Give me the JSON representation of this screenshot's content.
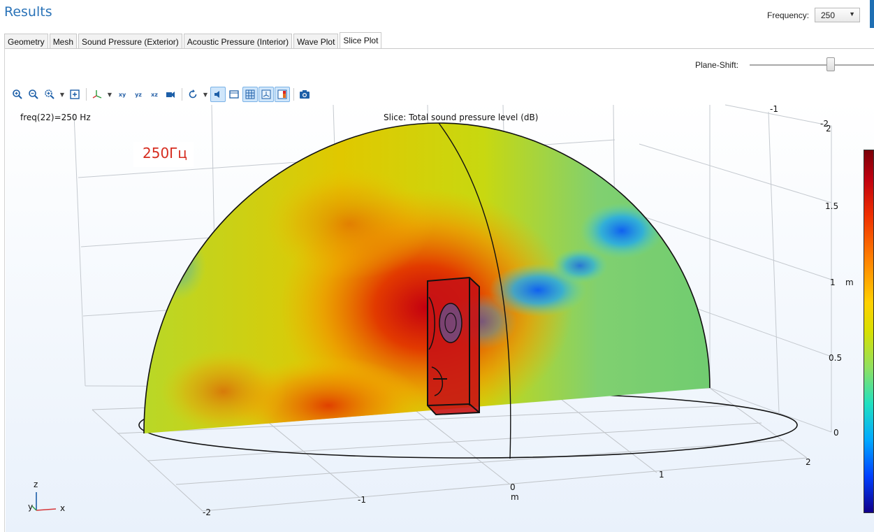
{
  "header": {
    "title": "Results",
    "frequency_label": "Frequency:",
    "frequency_value": "250"
  },
  "tabs": [
    {
      "label": "Geometry"
    },
    {
      "label": "Mesh"
    },
    {
      "label": "Sound Pressure (Exterior)"
    },
    {
      "label": "Acoustic Pressure (Interior)"
    },
    {
      "label": "Wave Plot"
    },
    {
      "label": "Slice Plot"
    }
  ],
  "active_tab": "Slice Plot",
  "controls": {
    "plane_shift_label": "Plane-Shift:",
    "plane_shift_position": 0.65
  },
  "toolbar": {
    "icons": [
      "zoom-in-icon",
      "zoom-out-icon",
      "zoom-box-icon",
      "zoom-extents-icon",
      "axis-orientation-icon",
      "xy-view-icon",
      "yz-view-icon",
      "xz-view-icon",
      "go-to-view-icon",
      "rotate-icon",
      "headlight-icon",
      "scene-light-icon",
      "grid-icon",
      "axis-icon",
      "color-legend-icon",
      "snapshot-icon"
    ],
    "xy_label": "xy",
    "yz_label": "yz",
    "xz_label": "xz"
  },
  "plot": {
    "freq_text": "freq(22)=250 Hz",
    "slice_title": "Slice: Total sound pressure level (dB)",
    "badge": "250Гц",
    "z_axis_ticks": [
      "2",
      "1.5",
      "1",
      "0.5",
      "0"
    ],
    "z_axis_unit": "m",
    "x_axis_ticks": [
      "-2",
      "-1",
      "0",
      "1",
      "2"
    ],
    "x_axis_unit": "m",
    "back_axis_ticks": [
      "-1",
      "-2"
    ],
    "triad_labels": {
      "z": "z",
      "y": "y",
      "x": "x"
    }
  },
  "colors": {
    "title": "#2a73b8",
    "badge": "#d62d20"
  }
}
